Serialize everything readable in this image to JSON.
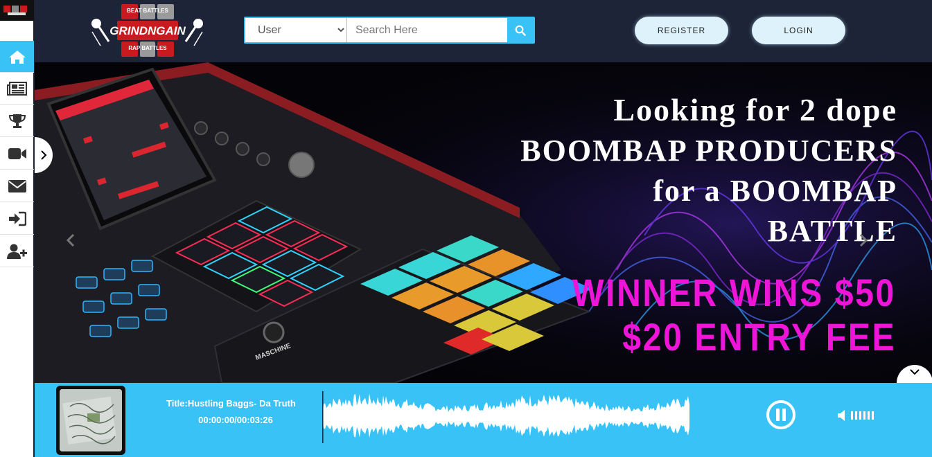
{
  "header": {
    "logo": {
      "top_text": "BEAT BATTLES",
      "main_text": "GRINDNGAIN",
      "bottom_text": "RAP BATTLES"
    },
    "search": {
      "type_selected": "User",
      "type_options": [
        "User"
      ],
      "placeholder": "Search Here"
    },
    "register_label": "REGISTER",
    "login_label": "LOGIN"
  },
  "sidebar": {
    "items": [
      {
        "name": "home",
        "icon": "home-icon",
        "active": true
      },
      {
        "name": "news",
        "icon": "newspaper-icon",
        "active": false
      },
      {
        "name": "battles",
        "icon": "trophy-icon",
        "active": false
      },
      {
        "name": "videos",
        "icon": "video-camera-icon",
        "active": false
      },
      {
        "name": "messages",
        "icon": "envelope-icon",
        "active": false
      },
      {
        "name": "sign-in",
        "icon": "sign-in-icon",
        "active": false
      },
      {
        "name": "add-user",
        "icon": "user-plus-icon",
        "active": false
      }
    ]
  },
  "hero": {
    "line1": "Looking for 2 dope",
    "line2": "BOOMBAP PRODUCERS",
    "line3": "for a BOOMBAP",
    "line4": "BATTLE",
    "prize": "WINNER WINS $50",
    "fee": "$20 ENTRY FEE",
    "device_label": "MASCHINE"
  },
  "player": {
    "title": "Title:Hustling Baggs- Da Truth",
    "time": "00:00:00/00:03:26",
    "elapsed_seconds": 0,
    "duration_seconds": 206,
    "state_icon": "pause-icon",
    "volume_icon": "volume-icon"
  },
  "colors": {
    "accent": "#38c2f5",
    "header_bg": "#1d2438",
    "hero_text": "#ffffff",
    "hero_highlight": "#ee14d8",
    "logo_red": "#c81a1f"
  }
}
